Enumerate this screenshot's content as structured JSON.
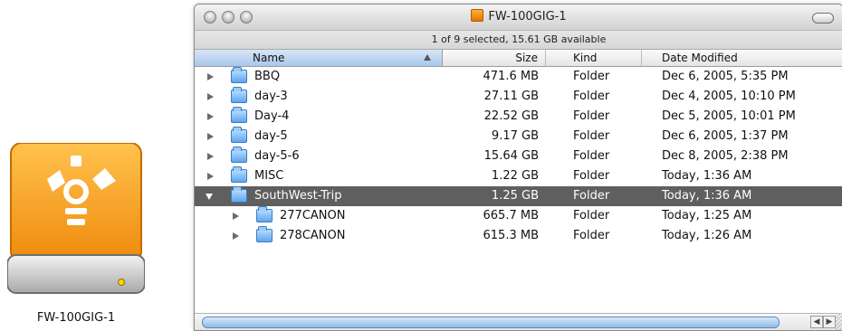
{
  "desktop": {
    "drive_label": "FW-100GIG-1",
    "drive_icon": "firewire-drive-icon"
  },
  "window": {
    "title": "FW-100GIG-1",
    "status": "1 of 9 selected, 15.61 GB available"
  },
  "columns": {
    "name": "Name",
    "size": "Size",
    "kind": "Kind",
    "date": "Date Modified"
  },
  "rows": [
    {
      "name": "BBQ",
      "size": "471.6 MB",
      "kind": "Folder",
      "date": "Dec 6, 2005, 5:35 PM"
    },
    {
      "name": "day-3",
      "size": "27.11 GB",
      "kind": "Folder",
      "date": "Dec 4, 2005, 10:10 PM"
    },
    {
      "name": "Day-4",
      "size": "22.52 GB",
      "kind": "Folder",
      "date": "Dec 5, 2005, 10:01 PM"
    },
    {
      "name": "day-5",
      "size": "9.17 GB",
      "kind": "Folder",
      "date": "Dec 6, 2005, 1:37 PM"
    },
    {
      "name": "day-5-6",
      "size": "15.64 GB",
      "kind": "Folder",
      "date": "Dec 8, 2005, 2:38 PM"
    },
    {
      "name": "MISC",
      "size": "1.22 GB",
      "kind": "Folder",
      "date": "Today, 1:36 AM"
    },
    {
      "name": "SouthWest-Trip",
      "size": "1.25 GB",
      "kind": "Folder",
      "date": "Today, 1:36 AM"
    },
    {
      "name": "277CANON",
      "size": "665.7 MB",
      "kind": "Folder",
      "date": "Today, 1:25 AM"
    },
    {
      "name": "278CANON",
      "size": "615.3 MB",
      "kind": "Folder",
      "date": "Today, 1:26 AM"
    }
  ],
  "colors": {
    "selected_row": "#5f5f5f",
    "folder_blue": "#5da6ee",
    "drive_orange": "#f39a1a"
  }
}
